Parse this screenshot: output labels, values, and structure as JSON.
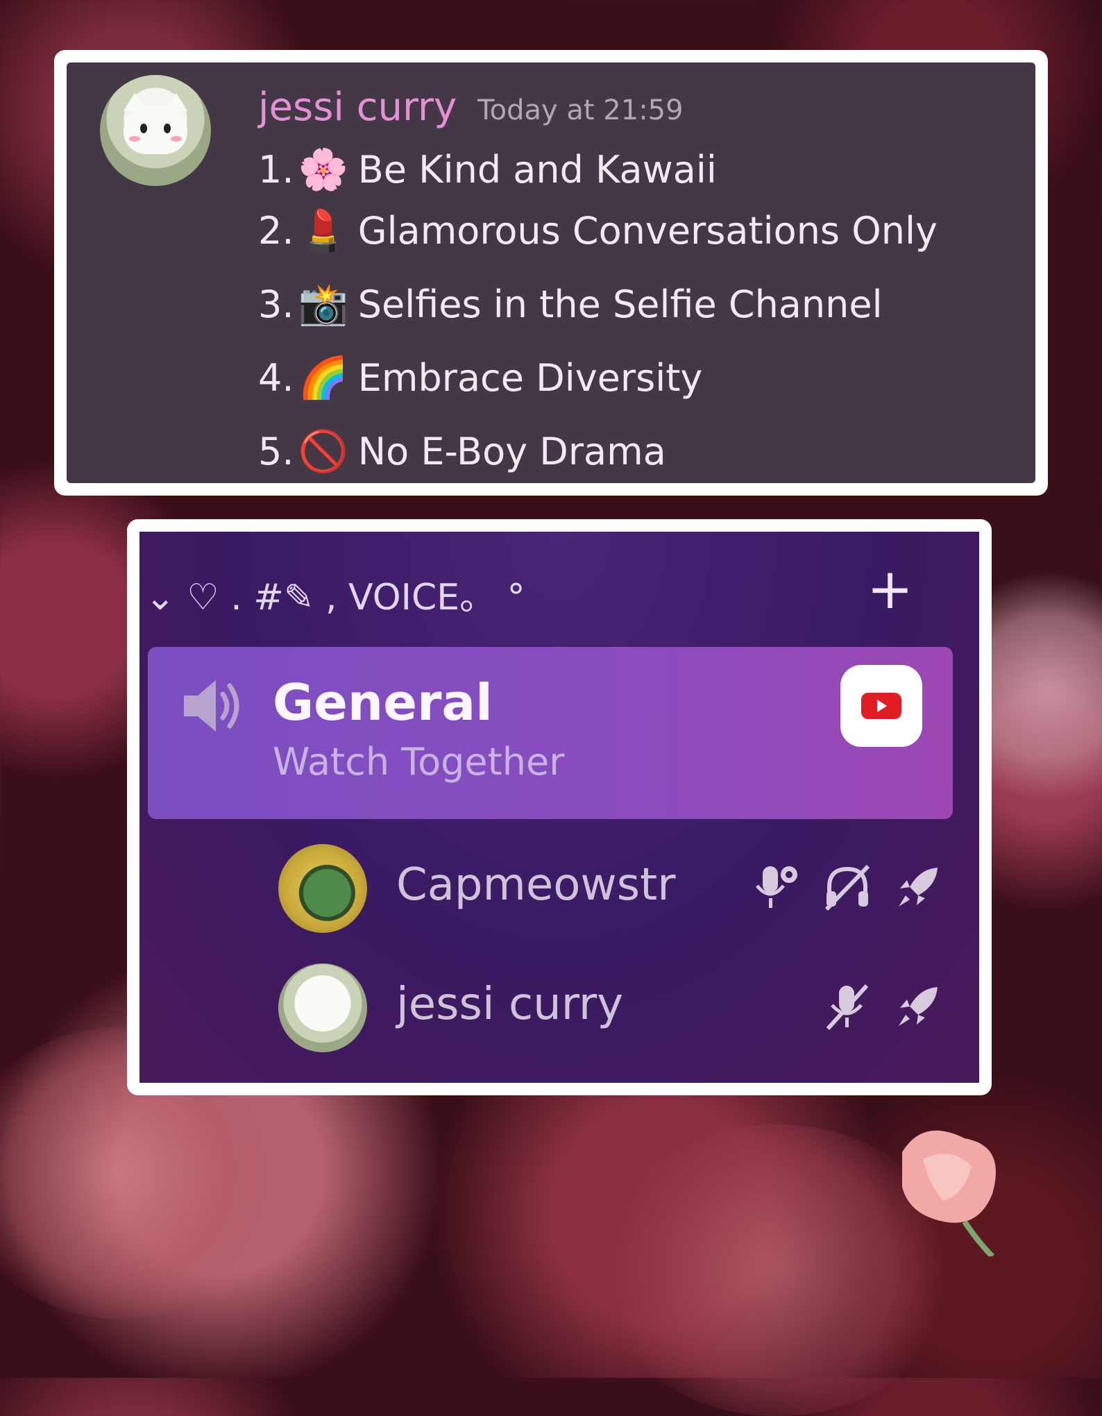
{
  "message": {
    "username": "jessi curry",
    "timestamp": "Today at 21:59",
    "rules": [
      {
        "num": "1.",
        "emoji": "🌸",
        "icon": "cherry-blossom-icon",
        "text": "Be Kind and Kawaii"
      },
      {
        "num": "2.",
        "emoji": "💄",
        "icon": "lipstick-icon",
        "text": "Glamorous Conversations Only"
      },
      {
        "num": "3.",
        "emoji": "📸",
        "icon": "camera-flash-icon",
        "text": "Selfies in the Selfie Channel"
      },
      {
        "num": "4.",
        "emoji": "🌈",
        "icon": "rainbow-icon",
        "text": "Embrace Diversity"
      },
      {
        "num": "5.",
        "emoji": "🚫",
        "icon": "prohibited-icon",
        "text": "No E-Boy Drama"
      }
    ]
  },
  "voice": {
    "category_label": "⌄ ♡ . #✎ , VOICE。 °",
    "add_icon": "+",
    "channel": {
      "name": "General",
      "status": "Watch Together",
      "activity_icon": "youtube-icon"
    },
    "members": [
      {
        "name": "Capmeowstr",
        "icons": [
          "mic-settings-icon",
          "deafened-headphones-icon",
          "boost-rocket-icon"
        ]
      },
      {
        "name": "jessi curry",
        "icons": [
          "muted-mic-icon",
          "boost-rocket-icon"
        ]
      }
    ]
  },
  "colors": {
    "username": "#e58fd6",
    "message_bg": "#453846",
    "channel_highlight": "#8a4cbf",
    "youtube_red": "#e21c24"
  }
}
